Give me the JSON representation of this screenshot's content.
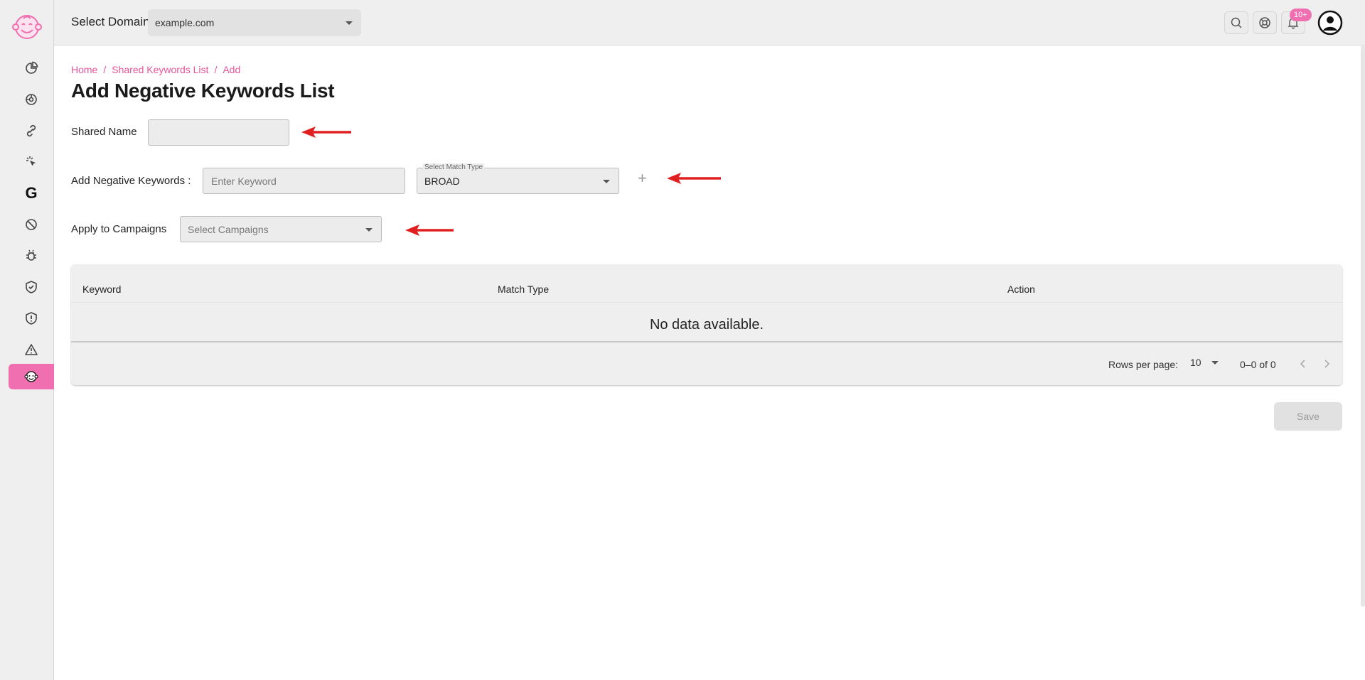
{
  "topbar": {
    "domain_label": "Select Domain",
    "domain_value": "example.com",
    "notification_badge": "10+"
  },
  "sidebar": {
    "items": [
      {
        "icon": "pie-chart-icon"
      },
      {
        "icon": "dashboard-icon"
      },
      {
        "icon": "link-icon"
      },
      {
        "icon": "click-icon"
      },
      {
        "icon": "google-icon",
        "label": "G"
      },
      {
        "icon": "block-icon"
      },
      {
        "icon": "bug-icon"
      },
      {
        "icon": "shield-check-icon"
      },
      {
        "icon": "shield-alert-icon"
      },
      {
        "icon": "warning-icon"
      },
      {
        "icon": "mascot-icon",
        "active": true
      }
    ]
  },
  "breadcrumb": [
    "Home",
    "Shared Keywords List",
    "Add"
  ],
  "page_title": "Add Negative Keywords List",
  "form": {
    "shared_name_label": "Shared Name",
    "shared_name_value": "",
    "keywords_label": "Add Negative Keywords :",
    "keyword_placeholder": "Enter Keyword",
    "match_type_label": "Select Match Type",
    "match_type_value": "BROAD",
    "campaigns_label": "Apply to Campaigns",
    "campaigns_placeholder": "Select Campaigns"
  },
  "table": {
    "columns": [
      "Keyword",
      "Match Type",
      "Action"
    ],
    "empty_text": "No data available.",
    "rows_per_page_label": "Rows per page:",
    "rows_per_page": "10",
    "range": "0–0 of 0"
  },
  "save_label": "Save",
  "colors": {
    "accent": "#f06fb0",
    "breadcrumb": "#e8549a",
    "annotation_arrow": "#e02020"
  }
}
